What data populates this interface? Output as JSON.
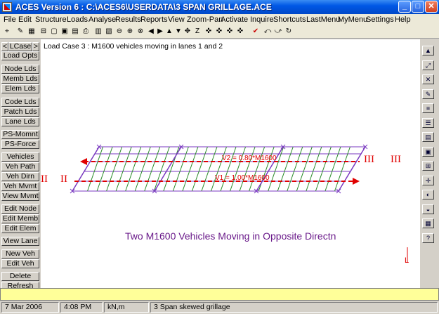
{
  "window": {
    "title": "ACES Version 6 : C:\\ACES6\\USERDATA\\3 SPAN GRILLAGE.ACE",
    "minimize": "_",
    "maximize": "□",
    "close": "✕"
  },
  "menu": [
    "File",
    "Edit",
    "Structure",
    "Loads",
    "Analyse",
    "Results",
    "Reports",
    "View",
    "Zoom-Pan",
    "Activate",
    "Inquire",
    "Shortcuts",
    "LastMenu",
    "MyMenu",
    "Settings",
    "Help"
  ],
  "toolbar_icons": [
    "select-icon",
    "edit-icon",
    "grid-icon",
    "print-setup-icon",
    "new-icon",
    "open-icon",
    "save-icon",
    "print-icon",
    "zoom-window-icon",
    "zoom-fit-icon",
    "zoom-prev-icon",
    "zoom-in-icon",
    "zoom-out-icon",
    "pan-left-icon",
    "pan-right-icon",
    "pan-up-icon",
    "pan-down-icon",
    "pan-center-icon",
    "z-icon",
    "rotate-1-icon",
    "rotate-2-icon",
    "rotate-3-icon",
    "rotate-4-icon",
    "check-icon",
    "undo-icon",
    "redo-icon",
    "refresh-icon"
  ],
  "sidebar": {
    "lcase_prev": "<",
    "lcase_label": "LCase",
    "lcase_next": ">",
    "buttons": [
      "Load Opts",
      "Node Lds",
      "Memb Lds",
      "Elem Lds",
      "Code Lds",
      "Patch Lds",
      "Lane Lds",
      "PS-Momnt",
      "PS-Force",
      "Vehicles",
      "Veh Path",
      "Veh Dirn",
      "Veh Mvmt",
      "View Mvmt",
      "Edit Node",
      "Edit Memb",
      "Edit Elem",
      "View Lane",
      "New Veh",
      "Edit Veh",
      "Delete",
      "Refresh"
    ]
  },
  "canvas": {
    "load_case": "Load Case  3 : M1600 vehicles moving in lanes 1 and 2",
    "v2_label": "V2 = 0.80*M1600",
    "v1_label": "V1 = 1.00*M1600",
    "left_marks_1": "II",
    "left_marks_2": "II",
    "right_marks_1": "III",
    "right_marks_2": "III",
    "caption": "Two M1600 Vehicles Moving in Opposite Directn",
    "axis_label": "L"
  },
  "right_toolbar_icons": [
    "view-3d-icon",
    "view-iso-icon",
    "view-plan-icon",
    "view-elev-icon",
    "layers-icon",
    "numbering-icon",
    "members-icon",
    "nodes-icon",
    "supports-icon",
    "loads-icon",
    "results-icon",
    "diagram-icon",
    "mesh-icon",
    "help-icon"
  ],
  "status": {
    "date": "7 Mar 2006",
    "time": "4:08 PM",
    "units": "kN,m",
    "model": "3 Span skewed grillage"
  },
  "colors": {
    "grid_purple": "#7a3ac0",
    "grid_green": "#2a8a2a",
    "lane_red": "#e00000",
    "caption": "#6a1a8a"
  }
}
